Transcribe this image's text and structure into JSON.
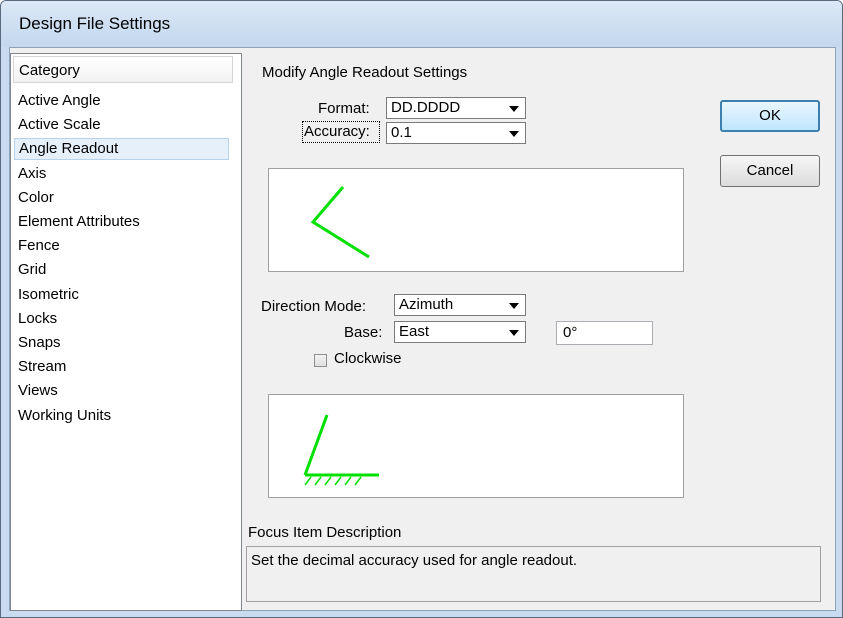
{
  "window": {
    "title": "Design File Settings"
  },
  "category": {
    "header": "Category",
    "items": [
      "Active Angle",
      "Active Scale",
      "Angle Readout",
      "Axis",
      "Color",
      "Element Attributes",
      "Fence",
      "Grid",
      "Isometric",
      "Locks",
      "Snaps",
      "Stream",
      "Views",
      "Working Units"
    ],
    "selected": "Angle Readout"
  },
  "panel": {
    "heading": "Modify Angle Readout Settings",
    "format_label": "Format:",
    "format_value": "DD.DDDD",
    "accuracy_label": "Accuracy:",
    "accuracy_value": "0.1",
    "direction_mode_label": "Direction Mode:",
    "direction_mode_value": "Azimuth",
    "base_label": "Base:",
    "base_value": "East",
    "base_angle_value": "0°",
    "clockwise_label": "Clockwise",
    "clockwise_checked": false
  },
  "buttons": {
    "ok": "OK",
    "cancel": "Cancel"
  },
  "description": {
    "label": "Focus Item Description",
    "text": "Set the decimal accuracy used for angle readout."
  },
  "colors": {
    "preview_line": "#00e000",
    "selection": "#e6f0fa"
  }
}
